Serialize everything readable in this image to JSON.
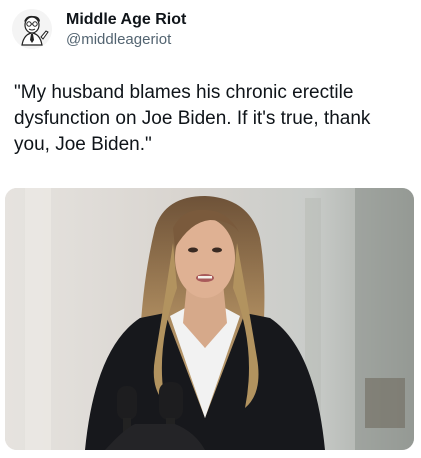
{
  "tweet": {
    "author": {
      "display_name": "Middle Age Riot",
      "handle": "@middleageriot",
      "avatar_icon": "cartoon-man-avatar-icon"
    },
    "text": "\"My husband blames his chronic erectile dysfunction on Joe Biden. If it's true, thank you, Joe Biden.\"",
    "media": {
      "type": "photo"
    }
  },
  "colors": {
    "text_primary": "#0f1419",
    "text_secondary": "#536471",
    "background": "#ffffff"
  }
}
